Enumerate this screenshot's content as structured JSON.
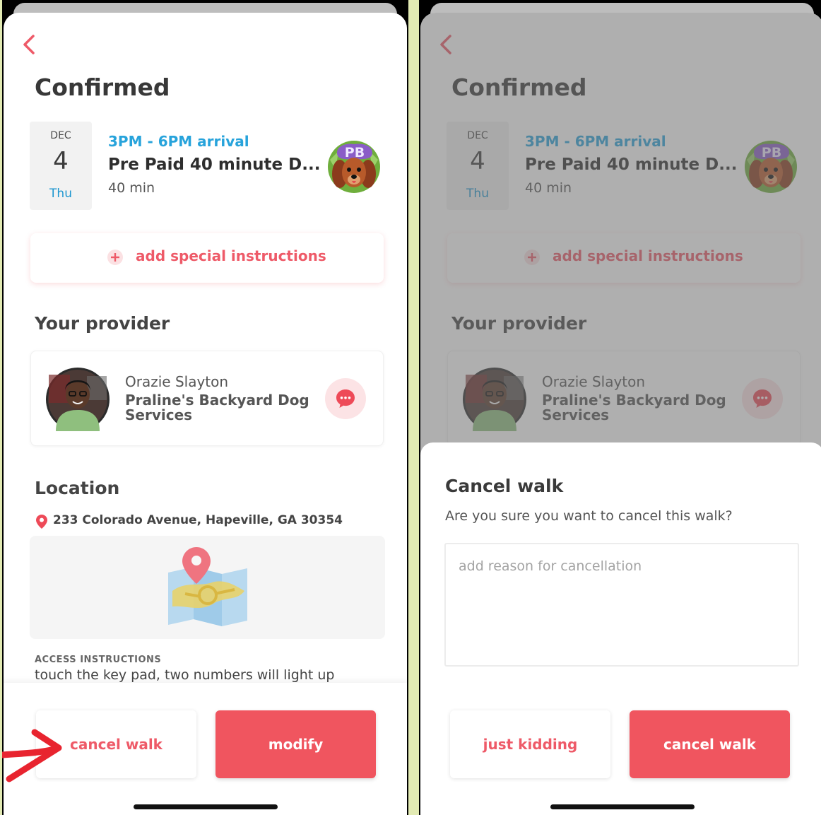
{
  "booking": {
    "status_title": "Confirmed",
    "date": {
      "month": "DEC",
      "day": "4",
      "weekday": "Thu"
    },
    "time_window": "3PM - 6PM arrival",
    "service_name": "Pre Paid 40 minute D...",
    "duration": "40 min",
    "special_instructions_label": "add special instructions"
  },
  "provider": {
    "section_title": "Your provider",
    "name": "Orazie Slayton",
    "business": "Praline's Backyard Dog Services"
  },
  "location": {
    "section_title": "Location",
    "address": "233 Colorado Avenue, Hapeville, GA 30354",
    "access_label": "ACCESS INSTRUCTIONS",
    "access_text": "touch the key pad, two numbers will light up"
  },
  "actions": {
    "cancel_label": "cancel walk",
    "modify_label": "modify"
  },
  "cancel_dialog": {
    "title": "Cancel walk",
    "question": "Are you sure you want to cancel this walk?",
    "reason_placeholder": "add reason for cancellation",
    "dismiss_label": "just kidding",
    "confirm_label": "cancel walk"
  },
  "colors": {
    "accent": "#f0555f",
    "accent_text": "#ee5a68",
    "time_blue": "#27a3db",
    "frame_bg": "#e2eab3",
    "annotation_arrow": "#e8242f"
  },
  "icons": {
    "back": "chevron-left-icon",
    "add": "plus-circle-icon",
    "message": "chat-bubble-icon",
    "location": "map-pin-icon",
    "map": "map-illustration-icon",
    "annotation": "red-arrow-icon"
  }
}
